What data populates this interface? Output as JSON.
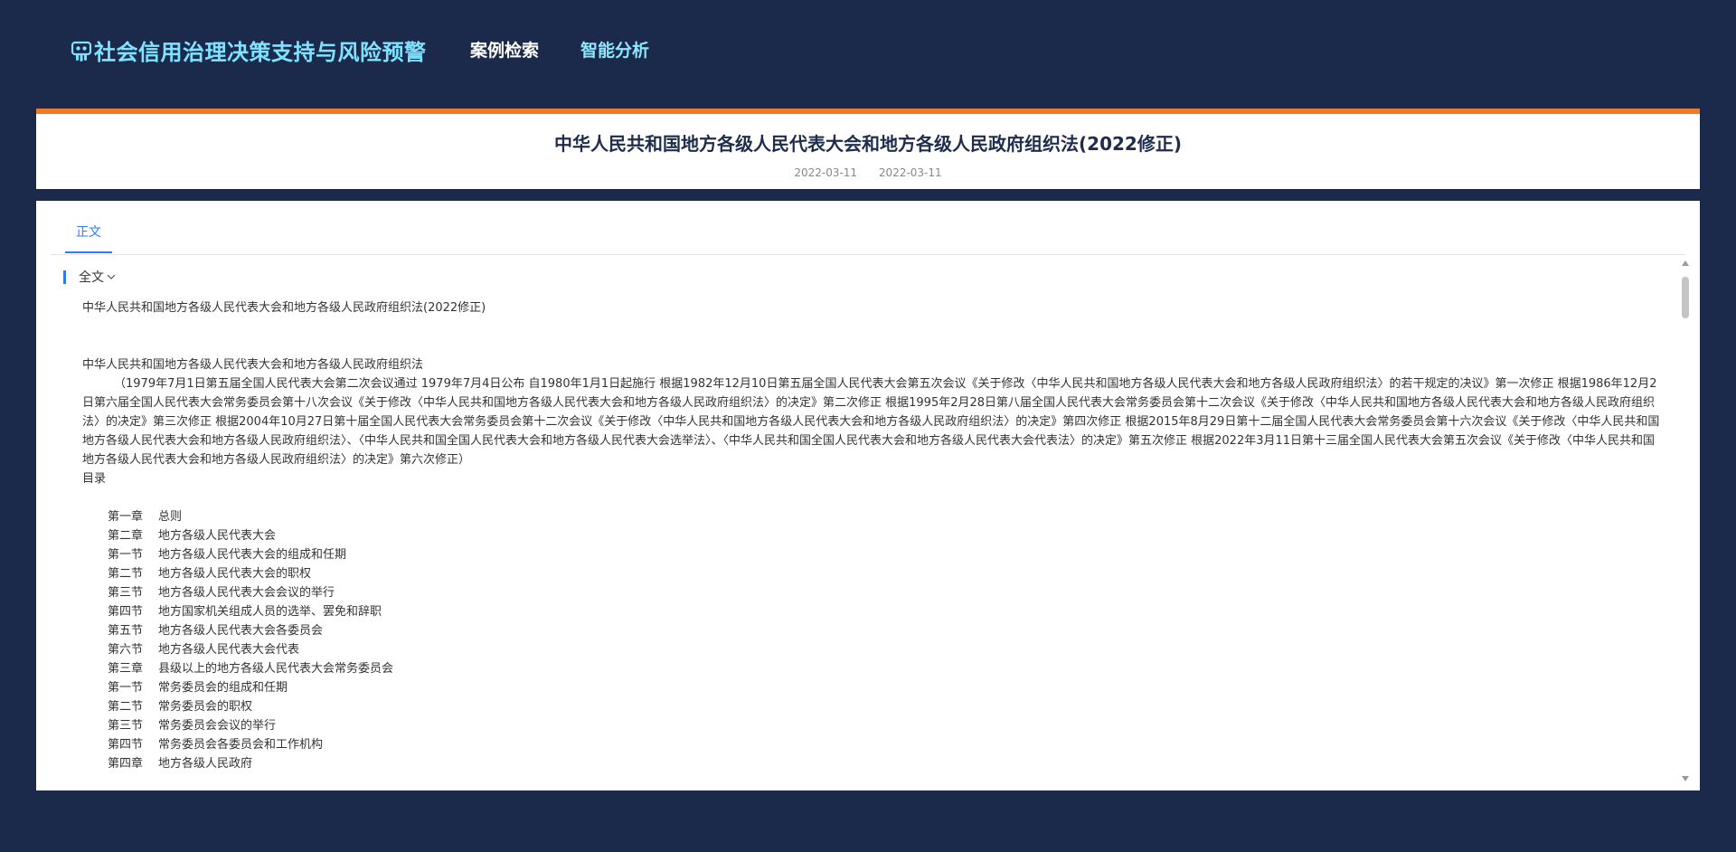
{
  "app": {
    "title": "社会信用治理决策支持与风险预警",
    "logo_icon": "robot-head-icon",
    "accent_color": "#7fe2ff",
    "background_color": "#1b2a4a"
  },
  "nav": {
    "items": [
      {
        "label": "案例检索"
      },
      {
        "label": "智能分析"
      }
    ]
  },
  "document": {
    "title": "中华人民共和国地方各级人民代表大会和地方各级人民政府组织法(2022修正)",
    "date_published": "2022-03-11",
    "date_effective": "2022-03-11",
    "header_border_color": "#ef7b2a"
  },
  "tabs": [
    {
      "label": "正文",
      "active": true
    }
  ],
  "section": {
    "label": "全文",
    "toggle_icon": "chevron-down-icon"
  },
  "body": {
    "heading": "中华人民共和国地方各级人民代表大会和地方各级人民政府组织法(2022修正)",
    "law_name": "中华人民共和国地方各级人民代表大会和地方各级人民政府组织法",
    "history": "（1979年7月1日第五届全国人民代表大会第二次会议通过 1979年7月4日公布 自1980年1月1日起施行 根据1982年12月10日第五届全国人民代表大会第五次会议《关于修改〈中华人民共和国地方各级人民代表大会和地方各级人民政府组织法〉的若干规定的决议》第一次修正 根据1986年12月2日第六届全国人民代表大会常务委员会第十八次会议《关于修改〈中华人民共和国地方各级人民代表大会和地方各级人民政府组织法〉的决定》第二次修正 根据1995年2月28日第八届全国人民代表大会常务委员会第十二次会议《关于修改〈中华人民共和国地方各级人民代表大会和地方各级人民政府组织法〉的决定》第三次修正 根据2004年10月27日第十届全国人民代表大会常务委员会第十二次会议《关于修改〈中华人民共和国地方各级人民代表大会和地方各级人民政府组织法〉的决定》第四次修正 根据2015年8月29日第十二届全国人民代表大会常务委员会第十六次会议《关于修改〈中华人民共和国地方各级人民代表大会和地方各级人民政府组织法〉、〈中华人民共和国全国人民代表大会和地方各级人民代表大会选举法〉、〈中华人民共和国全国人民代表大会和地方各级人民代表大会代表法〉的决定》第五次修正 根据2022年3月11日第十三届全国人民代表大会第五次会议《关于修改〈中华人民共和国地方各级人民代表大会和地方各级人民政府组织法〉的决定》第六次修正）",
    "toc_label": "目录",
    "toc": [
      {
        "num": "第一章",
        "title": "总则"
      },
      {
        "num": "第二章",
        "title": "地方各级人民代表大会"
      },
      {
        "num": "第一节",
        "title": "地方各级人民代表大会的组成和任期"
      },
      {
        "num": "第二节",
        "title": "地方各级人民代表大会的职权"
      },
      {
        "num": "第三节",
        "title": "地方各级人民代表大会会议的举行"
      },
      {
        "num": "第四节",
        "title": "地方国家机关组成人员的选举、罢免和辞职"
      },
      {
        "num": "第五节",
        "title": "地方各级人民代表大会各委员会"
      },
      {
        "num": "第六节",
        "title": "地方各级人民代表大会代表"
      },
      {
        "num": "第三章",
        "title": "县级以上的地方各级人民代表大会常务委员会"
      },
      {
        "num": "第一节",
        "title": "常务委员会的组成和任期"
      },
      {
        "num": "第二节",
        "title": "常务委员会的职权"
      },
      {
        "num": "第三节",
        "title": "常务委员会会议的举行"
      },
      {
        "num": "第四节",
        "title": "常务委员会各委员会和工作机构"
      },
      {
        "num": "第四章",
        "title": "地方各级人民政府"
      }
    ]
  }
}
